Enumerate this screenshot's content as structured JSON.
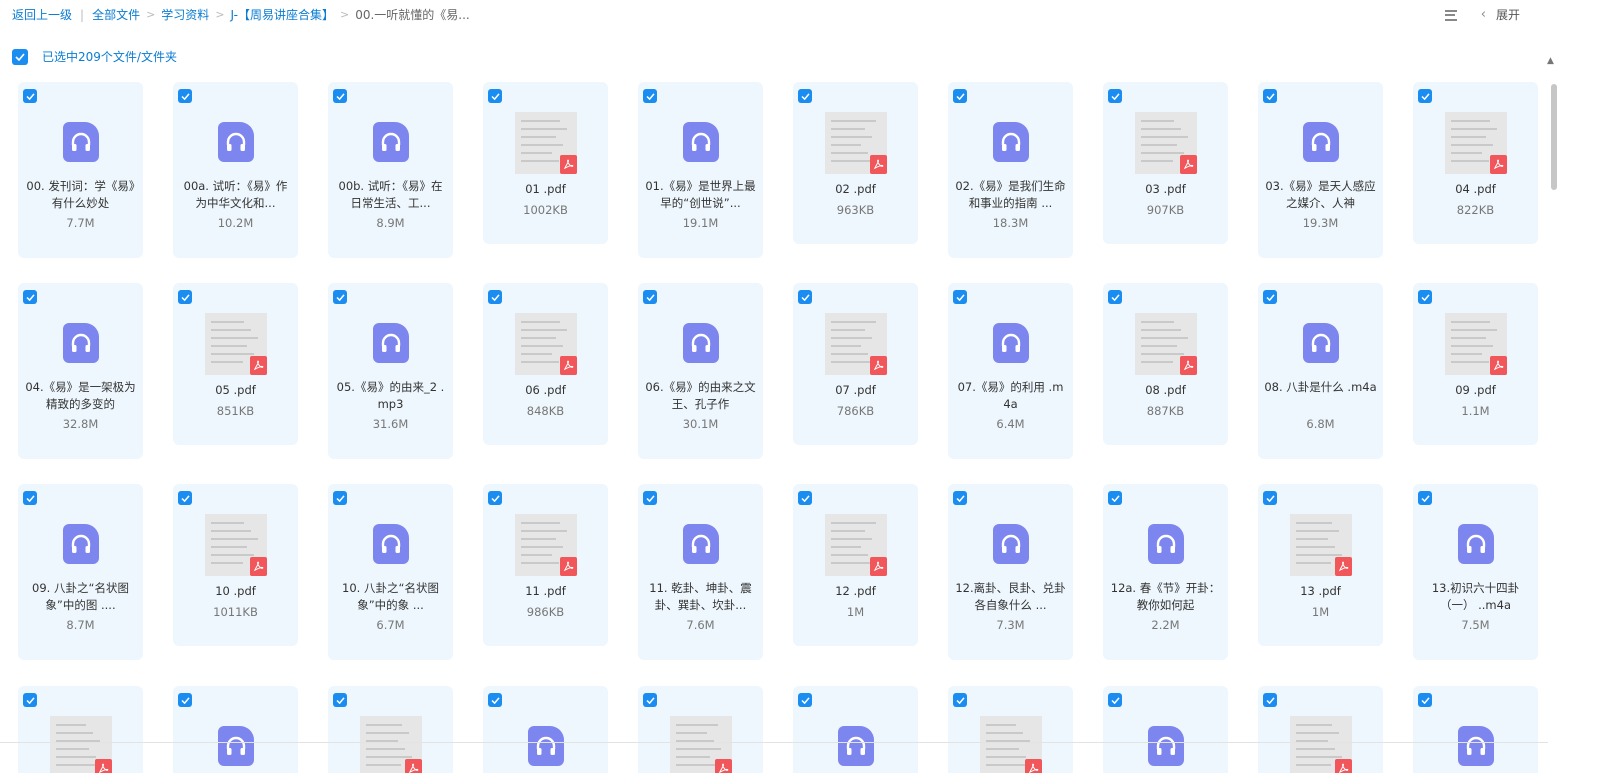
{
  "breadcrumb": {
    "back": "返回上一级",
    "items": [
      "全部文件",
      "学习资料",
      "J-【周易讲座合集】",
      "00.一听就懂的《易..."
    ]
  },
  "toolbar": {
    "expand_label": "展开"
  },
  "selection": {
    "text": "已选中209个文件/文件夹"
  },
  "colors": {
    "accent": "#1b8df0",
    "audio_icon": "#7d86ef",
    "pdf_badge": "#f0565a",
    "card_bg": "#eef7fd"
  },
  "files": [
    {
      "type": "audio",
      "name": "00. 发刊词：学《易》有什么妙处",
      "size": "7.7M"
    },
    {
      "type": "audio",
      "name": "00a. 试听：《易》作为中华文化和...",
      "size": "10.2M"
    },
    {
      "type": "audio",
      "name": "00b. 试听：《易》在日常生活、工...",
      "size": "8.9M"
    },
    {
      "type": "pdf",
      "name": "01 .pdf",
      "size": "1002KB"
    },
    {
      "type": "audio",
      "name": "01.《易》是世界上最早的“创世说”...",
      "size": "19.1M"
    },
    {
      "type": "pdf",
      "name": "02 .pdf",
      "size": "963KB"
    },
    {
      "type": "audio",
      "name": "02.《易》是我们生命和事业的指南 ...",
      "size": "18.3M"
    },
    {
      "type": "pdf",
      "name": "03 .pdf",
      "size": "907KB"
    },
    {
      "type": "audio",
      "name": "03.《易》是天人感应之媒介、人神",
      "size": "19.3M"
    },
    {
      "type": "pdf",
      "name": "04 .pdf",
      "size": "822KB"
    },
    {
      "type": "audio",
      "name": "04.《易》是一架极为精致的多变的",
      "size": "32.8M"
    },
    {
      "type": "pdf",
      "name": "05 .pdf",
      "size": "851KB"
    },
    {
      "type": "audio",
      "name": "05.《易》的由来_2 .mp3",
      "size": "31.6M"
    },
    {
      "type": "pdf",
      "name": "06 .pdf",
      "size": "848KB"
    },
    {
      "type": "audio",
      "name": "06.《易》的由来之文王、孔子作",
      "size": "30.1M"
    },
    {
      "type": "pdf",
      "name": "07 .pdf",
      "size": "786KB"
    },
    {
      "type": "audio",
      "name": "07.《易》的利用 .m4a",
      "size": "6.4M"
    },
    {
      "type": "pdf",
      "name": "08 .pdf",
      "size": "887KB"
    },
    {
      "type": "audio",
      "name": "08. 八卦是什么 .m4a",
      "size": "6.8M"
    },
    {
      "type": "pdf",
      "name": "09 .pdf",
      "size": "1.1M"
    },
    {
      "type": "audio",
      "name": "09. 八卦之“名状图象”中的图 ....",
      "size": "8.7M"
    },
    {
      "type": "pdf",
      "name": "10 .pdf",
      "size": "1011KB"
    },
    {
      "type": "audio",
      "name": "10. 八卦之“名状图象”中的象 ...",
      "size": "6.7M"
    },
    {
      "type": "pdf",
      "name": "11 .pdf",
      "size": "986KB"
    },
    {
      "type": "audio",
      "name": "11. 乾卦、坤卦、震卦、巽卦、坎卦...",
      "size": "7.6M"
    },
    {
      "type": "pdf",
      "name": "12 .pdf",
      "size": "1M"
    },
    {
      "type": "audio",
      "name": "12.离卦、艮卦、兑卦各自象什么 ...",
      "size": "7.3M"
    },
    {
      "type": "audio",
      "name": "12a. 春《节》开卦：教你如何起",
      "size": "2.2M"
    },
    {
      "type": "pdf",
      "name": "13 .pdf",
      "size": "1M"
    },
    {
      "type": "audio",
      "name": "13.初识六十四卦（一） ..m4a",
      "size": "7.5M"
    },
    {
      "type": "pdf",
      "name": "",
      "size": ""
    },
    {
      "type": "audio",
      "name": "",
      "size": ""
    },
    {
      "type": "pdf",
      "name": "",
      "size": ""
    },
    {
      "type": "audio",
      "name": "",
      "size": ""
    },
    {
      "type": "pdf",
      "name": "",
      "size": ""
    },
    {
      "type": "audio",
      "name": "",
      "size": ""
    },
    {
      "type": "pdf",
      "name": "",
      "size": ""
    },
    {
      "type": "audio",
      "name": "",
      "size": ""
    },
    {
      "type": "pdf",
      "name": "",
      "size": ""
    },
    {
      "type": "audio",
      "name": "",
      "size": ""
    }
  ]
}
